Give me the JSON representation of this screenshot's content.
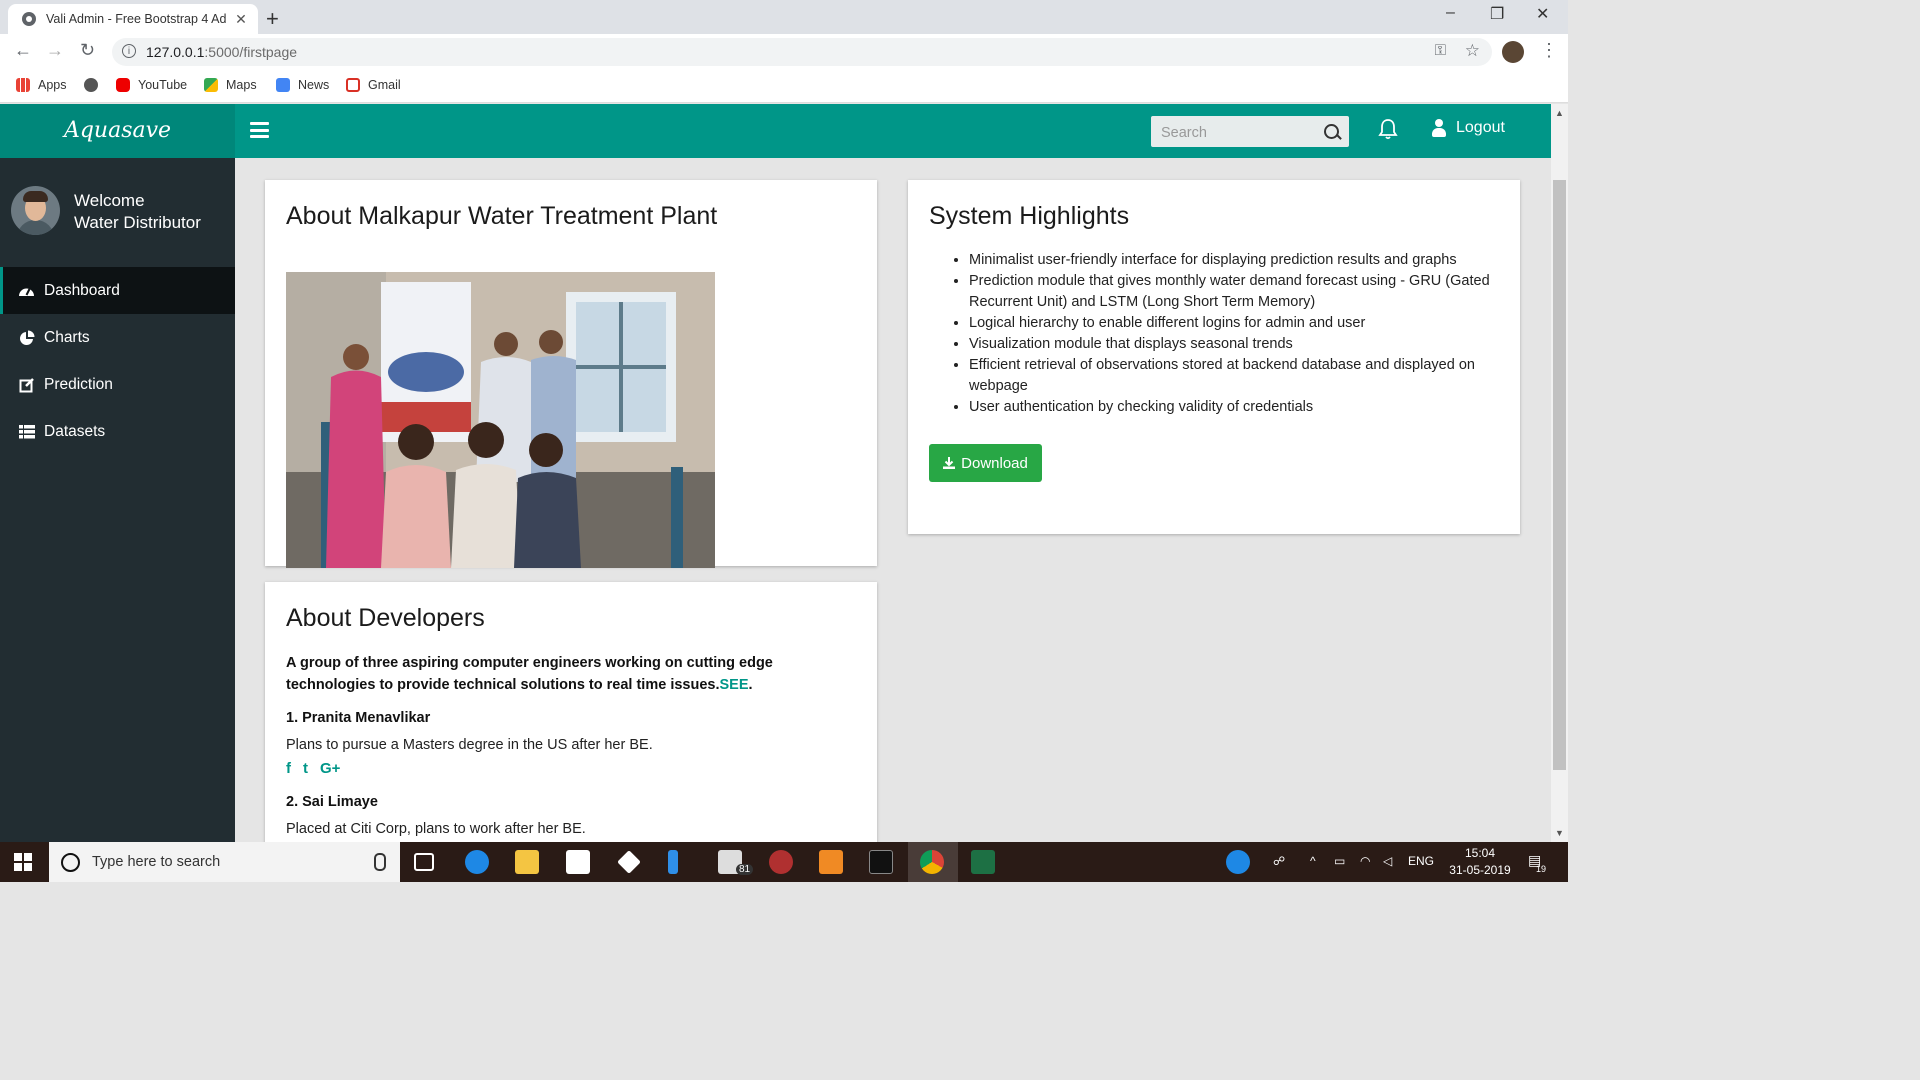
{
  "browser": {
    "tab_title": "Vali Admin - Free Bootstrap 4 Ad",
    "url_host": "127.0.0.1",
    "url_path": ":5000/firstpage",
    "bookmarks": [
      {
        "label": "Apps",
        "icon": "apps-grid-icon"
      },
      {
        "label": "",
        "icon": "globe-icon"
      },
      {
        "label": "YouTube",
        "icon": "youtube-icon"
      },
      {
        "label": "Maps",
        "icon": "maps-icon"
      },
      {
        "label": "News",
        "icon": "news-icon"
      },
      {
        "label": "Gmail",
        "icon": "gmail-icon"
      }
    ]
  },
  "header": {
    "logo": "Aquasave",
    "search_placeholder": "Search",
    "logout_label": "Logout",
    "brand_color": "#009688"
  },
  "sidebar": {
    "welcome_line1": "Welcome",
    "welcome_line2": "Water Distributor",
    "items": [
      {
        "label": "Dashboard",
        "icon": "dashboard-icon",
        "active": true
      },
      {
        "label": "Charts",
        "icon": "pie-chart-icon",
        "active": false
      },
      {
        "label": "Prediction",
        "icon": "edit-icon",
        "active": false
      },
      {
        "label": "Datasets",
        "icon": "list-icon",
        "active": false
      }
    ]
  },
  "plant": {
    "title": "About Malkapur Water Treatment Plant"
  },
  "highlights": {
    "title": "System Highlights",
    "items": [
      "Minimalist user-friendly interface for displaying prediction results and graphs",
      "Prediction module that gives monthly water demand forecast using - GRU (Gated Recurrent Unit) and LSTM (Long Short Term Memory)",
      "Logical hierarchy to enable different logins for admin and user",
      "Visualization module that displays seasonal trends",
      "Efficient retrieval of observations stored at backend database and displayed on webpage",
      "User authentication by checking validity of credentials"
    ],
    "download_label": "Download"
  },
  "developers": {
    "title": "About Developers",
    "intro": "A group of three aspiring computer engineers working on cutting edge technologies to provide technical solutions to real time issues.",
    "see_link": "SEE",
    "period": ".",
    "people": [
      {
        "name": "1. Pranita Menavlikar",
        "desc": "Plans to pursue a Masters degree in the US after her BE."
      },
      {
        "name": "2. Sai Limaye",
        "desc": "Placed at Citi Corp, plans to work after her BE."
      }
    ],
    "social": [
      "f",
      "t",
      "G+"
    ]
  },
  "taskbar": {
    "search_placeholder": "Type here to search",
    "mail_badge": "81",
    "language": "ENG",
    "time": "15:04",
    "date": "31-05-2019",
    "notif_count": "19"
  }
}
